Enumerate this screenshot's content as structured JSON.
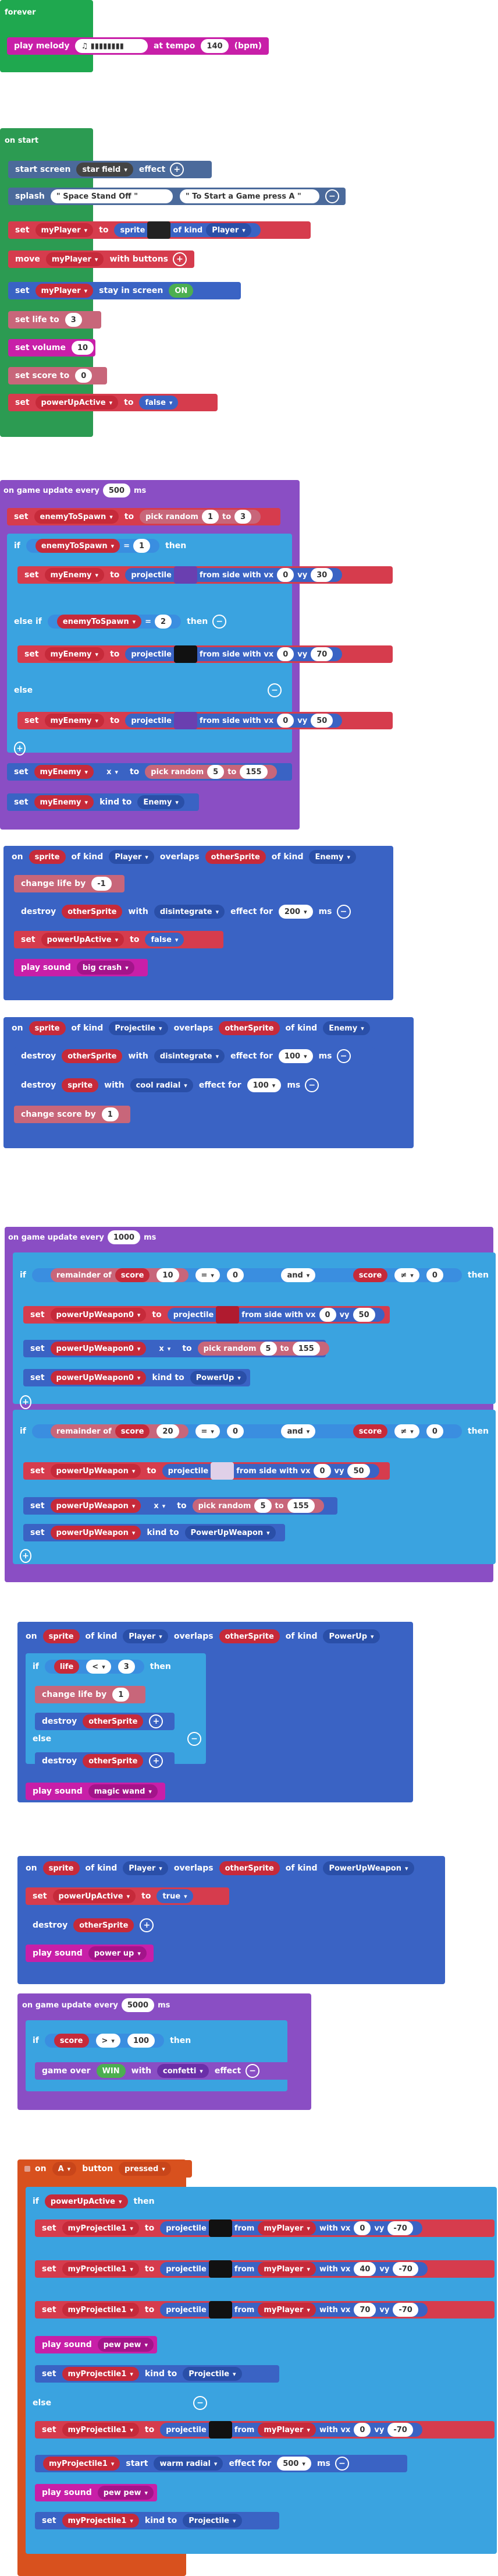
{
  "colors": {
    "loops": "#1fa84f",
    "events": "#2c9b52",
    "scene": "#4b6a9b",
    "sprites": "#3a63c4",
    "variables": "#d63c4d",
    "logic": "#3aa3e0",
    "music": "#c81fa8",
    "info": "#c8667a",
    "game": "#8a4ec4",
    "controller": "#d8511e",
    "gray": "#535353"
  },
  "forever": {
    "label": "forever",
    "play": "play melody",
    "at_tempo": "at tempo",
    "tempo": "140",
    "bpm": "(bpm)"
  },
  "start": {
    "label": "on start",
    "start_screen": "start screen",
    "effect_name": "star field",
    "effect": "effect",
    "splash": "splash",
    "splash1": "\" Space Stand Off \"",
    "splash2": "\" To Start a Game press A \"",
    "set": "set",
    "to": "to",
    "sprite": "sprite",
    "of_kind": "of kind",
    "kind": "Player",
    "myPlayer": "myPlayer",
    "move": "move",
    "with_buttons": "with buttons",
    "stay": "stay in screen",
    "on": "ON",
    "set_life": "set life to",
    "life": "3",
    "set_volume": "set volume",
    "volume": "10",
    "set_score": "set score to",
    "score": "0",
    "powerUpActive": "powerUpActive",
    "false": "false"
  },
  "update500": {
    "label": "on game update every",
    "ms": "500",
    "ms_lbl": "ms",
    "enemyToSpawn": "enemyToSpawn",
    "pick_random": "pick random",
    "to": "to",
    "r1": "1",
    "r2": "3",
    "if": "if",
    "eq": "=",
    "then": "then",
    "one": "1",
    "two": "2",
    "else_if": "else if",
    "else": "else",
    "myEnemy": "myEnemy",
    "projectile": "projectile",
    "from_side": "from side with vx",
    "vx": "0",
    "vy": "vy",
    "vy1": "30",
    "vy2": "70",
    "vy3": "50",
    "x": "x",
    "r3": "5",
    "r4": "155",
    "kind_to": "kind to",
    "enemy": "Enemy"
  },
  "overlap1": {
    "on": "on",
    "sprite": "sprite",
    "of_kind": "of kind",
    "player": "Player",
    "overlaps": "overlaps",
    "otherSprite": "otherSprite",
    "enemy": "Enemy",
    "change_life": "change life by",
    "minus1": "-1",
    "destroy": "destroy",
    "with": "with",
    "disintegrate": "disintegrate",
    "effect_for": "effect for",
    "t200": "200",
    "ms": "ms",
    "set": "set",
    "powerUpActive": "powerUpActive",
    "to": "to",
    "false": "false",
    "play_sound": "play sound",
    "big_crash": "big crash"
  },
  "overlap2": {
    "projectile": "Projectile",
    "t100": "100",
    "cool_radial": "cool radial",
    "change_score": "change score by",
    "one": "1"
  },
  "update1000": {
    "label": "on game update every",
    "ms": "1000",
    "if": "if",
    "remainder": "remainder of",
    "score": "score",
    "mod10": "10",
    "eq": "=",
    "zero": "0",
    "and": "and",
    "neq": "≠",
    "then": "then",
    "mod20": "20",
    "set": "set",
    "powerUpWeapon0": "powerUpWeapon0",
    "powerUpWeapon": "powerUpWeapon",
    "projectile": "projectile",
    "from_side": "from side with vx",
    "vx": "0",
    "vy": "vy",
    "vy50": "50",
    "x": "x",
    "to": "to",
    "pick_random": "pick random",
    "r1": "5",
    "r2": "155",
    "kind_to": "kind to",
    "powerUp": "PowerUp",
    "powerUpWeapon_kind": "PowerUpWeapon"
  },
  "overlap3": {
    "on": "on",
    "sprite": "sprite",
    "of_kind": "of kind",
    "player": "Player",
    "overlaps": "overlaps",
    "otherSprite": "otherSprite",
    "powerUp": "PowerUp",
    "if": "if",
    "life": "life",
    "lt": "<",
    "three": "3",
    "then": "then",
    "change_life": "change life by",
    "one": "1",
    "destroy": "destroy",
    "else": "else",
    "play_sound": "play sound",
    "magic_wand": "magic wand"
  },
  "overlap4": {
    "powerUpWeapon": "PowerUpWeapon",
    "set": "set",
    "powerUpActive": "powerUpActive",
    "to": "to",
    "true": "true",
    "power_up": "power up"
  },
  "update5000": {
    "label": "on game update every",
    "ms": "5000",
    "if": "if",
    "score": "score",
    "gt": ">",
    "hundred": "100",
    "then": "then",
    "game_over": "game over",
    "win": "WIN",
    "with": "with",
    "confetti": "confetti",
    "effect": "effect"
  },
  "abutton": {
    "on": "on",
    "a": "A",
    "button": "button",
    "pressed": "pressed",
    "if": "if",
    "powerUpActive": "powerUpActive",
    "then": "then",
    "set": "set",
    "myProjectile1": "myProjectile1",
    "to": "to",
    "projectile": "projectile",
    "from": "from",
    "myPlayer": "myPlayer",
    "with_vx": "with vx",
    "vy": "vy",
    "v0": "0",
    "v40": "40",
    "v70": "70",
    "vm70": "-70",
    "play_sound": "play sound",
    "pew": "pew pew",
    "kind_to": "kind to",
    "projectile_kind": "Projectile",
    "else": "else",
    "start": "start",
    "warm_radial": "warm radial",
    "effect_for": "effect for",
    "t500": "500",
    "ms": "ms"
  }
}
